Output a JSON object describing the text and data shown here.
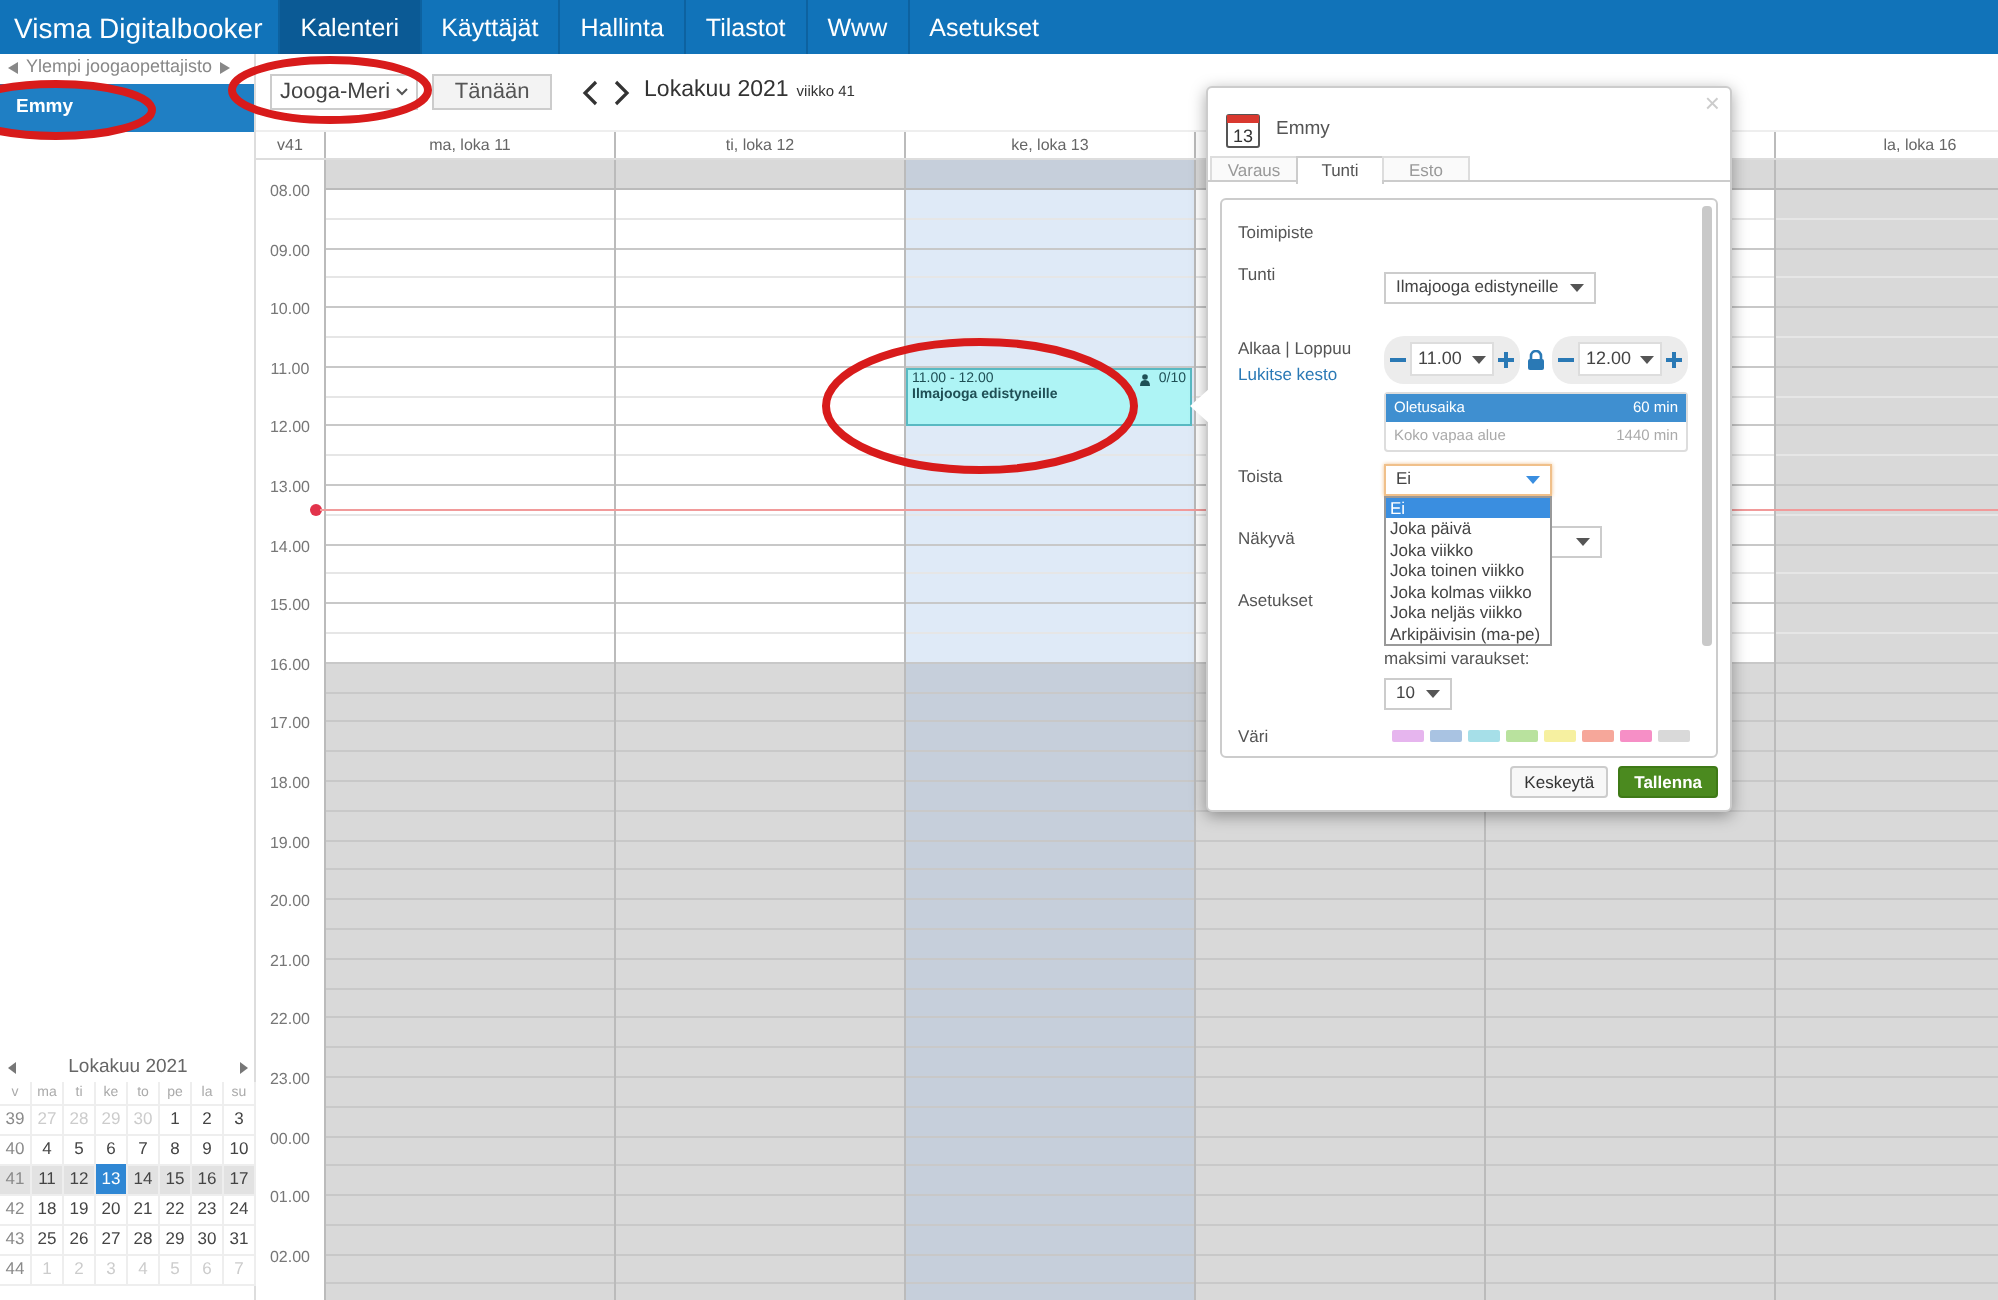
{
  "navbar": {
    "brand": "Visma Digitalbooker",
    "items": [
      {
        "label": "Kalenteri",
        "selected": true
      },
      {
        "label": "Käyttäjät",
        "selected": false
      },
      {
        "label": "Hallinta",
        "selected": false
      },
      {
        "label": "Tilastot",
        "selected": false
      },
      {
        "label": "Www",
        "selected": false
      },
      {
        "label": "Asetukset",
        "selected": false
      }
    ]
  },
  "sidebar": {
    "group_label": "Ylempi joogaopettajisto",
    "users": [
      {
        "name": "Emmy",
        "selected": true
      }
    ],
    "mini_calendar": {
      "title": "Lokakuu 2021",
      "weekday_header": [
        "v",
        "ma",
        "ti",
        "ke",
        "to",
        "pe",
        "la",
        "su"
      ],
      "weeks": [
        {
          "week": "39",
          "current": false,
          "days": [
            {
              "label": "27",
              "other_month": true,
              "selected": false
            },
            {
              "label": "28",
              "other_month": true,
              "selected": false
            },
            {
              "label": "29",
              "other_month": true,
              "selected": false
            },
            {
              "label": "30",
              "other_month": true,
              "selected": false
            },
            {
              "label": "1",
              "other_month": false,
              "selected": false
            },
            {
              "label": "2",
              "other_month": false,
              "selected": false
            },
            {
              "label": "3",
              "other_month": false,
              "selected": false
            }
          ]
        },
        {
          "week": "40",
          "current": false,
          "days": [
            {
              "label": "4",
              "other_month": false,
              "selected": false
            },
            {
              "label": "5",
              "other_month": false,
              "selected": false
            },
            {
              "label": "6",
              "other_month": false,
              "selected": false
            },
            {
              "label": "7",
              "other_month": false,
              "selected": false
            },
            {
              "label": "8",
              "other_month": false,
              "selected": false
            },
            {
              "label": "9",
              "other_month": false,
              "selected": false
            },
            {
              "label": "10",
              "other_month": false,
              "selected": false
            }
          ]
        },
        {
          "week": "41",
          "current": true,
          "days": [
            {
              "label": "11",
              "other_month": false,
              "selected": false
            },
            {
              "label": "12",
              "other_month": false,
              "selected": false
            },
            {
              "label": "13",
              "other_month": false,
              "selected": true
            },
            {
              "label": "14",
              "other_month": false,
              "selected": false
            },
            {
              "label": "15",
              "other_month": false,
              "selected": false
            },
            {
              "label": "16",
              "other_month": false,
              "selected": false
            },
            {
              "label": "17",
              "other_month": false,
              "selected": false
            }
          ]
        },
        {
          "week": "42",
          "current": false,
          "days": [
            {
              "label": "18",
              "other_month": false,
              "selected": false
            },
            {
              "label": "19",
              "other_month": false,
              "selected": false
            },
            {
              "label": "20",
              "other_month": false,
              "selected": false
            },
            {
              "label": "21",
              "other_month": false,
              "selected": false
            },
            {
              "label": "22",
              "other_month": false,
              "selected": false
            },
            {
              "label": "23",
              "other_month": false,
              "selected": false
            },
            {
              "label": "24",
              "other_month": false,
              "selected": false
            }
          ]
        },
        {
          "week": "43",
          "current": false,
          "days": [
            {
              "label": "25",
              "other_month": false,
              "selected": false
            },
            {
              "label": "26",
              "other_month": false,
              "selected": false
            },
            {
              "label": "27",
              "other_month": false,
              "selected": false
            },
            {
              "label": "28",
              "other_month": false,
              "selected": false
            },
            {
              "label": "29",
              "other_month": false,
              "selected": false
            },
            {
              "label": "30",
              "other_month": false,
              "selected": false
            },
            {
              "label": "31",
              "other_month": false,
              "selected": false
            }
          ]
        },
        {
          "week": "44",
          "current": false,
          "days": [
            {
              "label": "1",
              "other_month": true,
              "selected": false
            },
            {
              "label": "2",
              "other_month": true,
              "selected": false
            },
            {
              "label": "3",
              "other_month": true,
              "selected": false
            },
            {
              "label": "4",
              "other_month": true,
              "selected": false
            },
            {
              "label": "5",
              "other_month": true,
              "selected": false
            },
            {
              "label": "6",
              "other_month": true,
              "selected": false
            },
            {
              "label": "7",
              "other_month": true,
              "selected": false
            }
          ]
        }
      ]
    }
  },
  "toolbar": {
    "location": "Jooga-Meri",
    "today_button": "Tänään",
    "period": "Lokakuu 2021",
    "week": "viikko 41"
  },
  "calendar": {
    "week_label": "v41",
    "days": [
      {
        "label": "ma, loka 11",
        "today": false,
        "weekend": false
      },
      {
        "label": "ti, loka 12",
        "today": false,
        "weekend": false
      },
      {
        "label": "ke, loka 13",
        "today": true,
        "weekend": false,
        "events": [
          {
            "time": "11.00 - 12.00",
            "title": "Ilmajooga edistyneille",
            "count": "0/10"
          }
        ]
      },
      {
        "today": false,
        "weekend": false
      },
      {
        "today": false,
        "weekend": false
      },
      {
        "label": "la, loka 16",
        "today": false,
        "weekend": true
      }
    ],
    "hours": [
      {
        "label": "08.00",
        "open": true,
        "now": false
      },
      {
        "label": "09.00",
        "open": true,
        "now": false
      },
      {
        "label": "10.00",
        "open": true,
        "now": false
      },
      {
        "label": "11.00",
        "open": true,
        "now": false
      },
      {
        "label": "12.00",
        "open": true,
        "now": false
      },
      {
        "label": "13.00",
        "open": true,
        "now": true
      },
      {
        "label": "14.00",
        "open": true,
        "now": false
      },
      {
        "label": "15.00",
        "open": true,
        "now": false
      },
      {
        "label": "16.00",
        "open": false,
        "now": false
      },
      {
        "label": "17.00",
        "open": false,
        "now": false
      },
      {
        "label": "18.00",
        "open": false,
        "now": false
      },
      {
        "label": "19.00",
        "open": false,
        "now": false
      },
      {
        "label": "20.00",
        "open": false,
        "now": false
      },
      {
        "label": "21.00",
        "open": false,
        "now": false
      },
      {
        "label": "22.00",
        "open": false,
        "now": false
      },
      {
        "label": "23.00",
        "open": false,
        "now": false
      },
      {
        "label": "00.00",
        "open": false,
        "now": false
      },
      {
        "label": "01.00",
        "open": false,
        "now": false
      },
      {
        "label": "02.00",
        "open": false,
        "now": false
      }
    ]
  },
  "dialog": {
    "title": "Emmy",
    "calendar_icon_day": "13",
    "close": "×",
    "tabs": [
      {
        "label": "Varaus",
        "selected": false
      },
      {
        "label": "Tunti",
        "selected": true
      },
      {
        "label": "Esto",
        "selected": false
      }
    ],
    "section_title": "Toimipiste",
    "lesson": {
      "label": "Tunti",
      "value": "Ilmajooga edistyneille"
    },
    "time": {
      "label": "Alkaa | Loppuu",
      "lock_link": "Lukitse kesto",
      "start": "11.00",
      "end": "12.00",
      "locked": true,
      "durations": [
        {
          "name": "Oletusaika",
          "length": "60 min",
          "selected": true
        },
        {
          "name": "Koko vapaa alue",
          "length": "1440 min",
          "selected": false
        }
      ]
    },
    "repeat": {
      "label": "Toista",
      "value": "Ei",
      "expanded": true,
      "options": [
        {
          "label": "Ei",
          "selected": true
        },
        {
          "label": "Joka päivä",
          "selected": false
        },
        {
          "label": "Joka viikko",
          "selected": false
        },
        {
          "label": "Joka toinen viikko",
          "selected": false
        },
        {
          "label": "Joka kolmas viikko",
          "selected": false
        },
        {
          "label": "Joka neljäs viikko",
          "selected": false
        },
        {
          "label": "Arkipäivisin (ma-pe)",
          "selected": false
        }
      ]
    },
    "visible": {
      "label": "Näkyvä"
    },
    "settings": {
      "label": "Asetukset",
      "max_label": "maksimi varaukset:",
      "max_value": "10"
    },
    "colors": {
      "label": "Väri",
      "swatches": [
        {
          "color": "#e6b5ee"
        },
        {
          "color": "#a9c3e2"
        },
        {
          "color": "#a6dfe8"
        },
        {
          "color": "#b9e29e"
        },
        {
          "color": "#f6f0a0"
        },
        {
          "color": "#f6a79a"
        },
        {
          "color": "#f68fc6"
        },
        {
          "color": "#d9d9d9"
        }
      ]
    },
    "buttons": {
      "cancel": "Keskeytä",
      "save": "Tallenna"
    }
  }
}
